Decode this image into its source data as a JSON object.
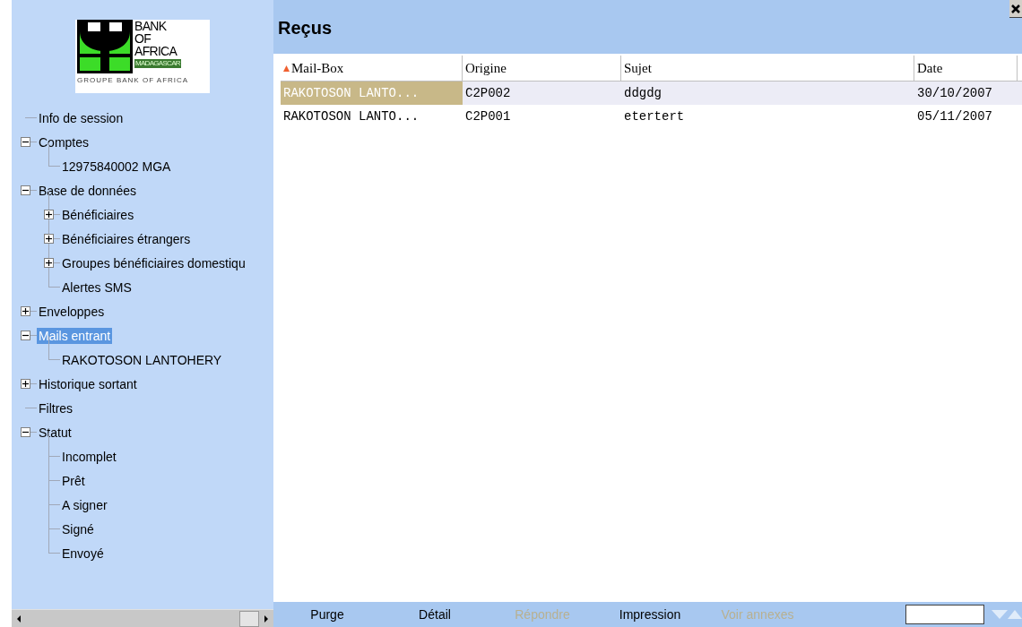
{
  "logo": {
    "line_1": "BANK",
    "line_2": "OF",
    "line_3": "AFRICA",
    "band": "MADAGASCAR",
    "tagline": "GROUPE BANK OF AFRICA"
  },
  "tree": [
    {
      "label": "Info de session",
      "selected": false
    },
    {
      "label": "Comptes",
      "expanded": true,
      "selected": false,
      "children": [
        {
          "label": "12975840002 MGA",
          "selected": false
        }
      ]
    },
    {
      "label": "Base de données",
      "expanded": true,
      "selected": false,
      "children": [
        {
          "label": "Bénéficiaires",
          "expanded": false,
          "selected": false
        },
        {
          "label": "Bénéficiaires étrangers",
          "expanded": false,
          "selected": false
        },
        {
          "label": "Groupes bénéficiaires domestiqu",
          "expanded": false,
          "selected": false
        },
        {
          "label": "Alertes SMS",
          "selected": false
        }
      ]
    },
    {
      "label": "Enveloppes",
      "expanded": false,
      "selected": false
    },
    {
      "label": "Mails entrant",
      "expanded": true,
      "selected": true,
      "children": [
        {
          "label": "RAKOTOSON LANTOHERY",
          "selected": false
        }
      ]
    },
    {
      "label": "Historique sortant",
      "expanded": false,
      "selected": false
    },
    {
      "label": "Filtres",
      "selected": false
    },
    {
      "label": "Statut",
      "expanded": true,
      "selected": false,
      "children": [
        {
          "label": "Incomplet",
          "selected": false
        },
        {
          "label": "Prêt",
          "selected": false
        },
        {
          "label": "A signer",
          "selected": false
        },
        {
          "label": "Signé",
          "selected": false
        },
        {
          "label": "Envoyé",
          "selected": false
        }
      ]
    }
  ],
  "panel_title": "Reçus",
  "table": {
    "columns": [
      {
        "label": "Mail-Box",
        "sorted": true
      },
      {
        "label": "Origine",
        "sorted": false
      },
      {
        "label": "Sujet",
        "sorted": false
      },
      {
        "label": "Date",
        "sorted": false
      }
    ],
    "rows": [
      {
        "cells": [
          "RAKOTOSON LANTO...",
          "C2P002",
          "ddgdg",
          "30/10/2007"
        ],
        "selected": true
      },
      {
        "cells": [
          "RAKOTOSON LANTO...",
          "C2P001",
          "etertert",
          "05/11/2007"
        ],
        "selected": false
      }
    ]
  },
  "actions": [
    {
      "label": "Purge",
      "disabled": false
    },
    {
      "label": "Détail",
      "disabled": false
    },
    {
      "label": "Répondre",
      "disabled": true
    },
    {
      "label": "Impression",
      "disabled": false
    },
    {
      "label": "Voir annexes",
      "disabled": true
    }
  ]
}
